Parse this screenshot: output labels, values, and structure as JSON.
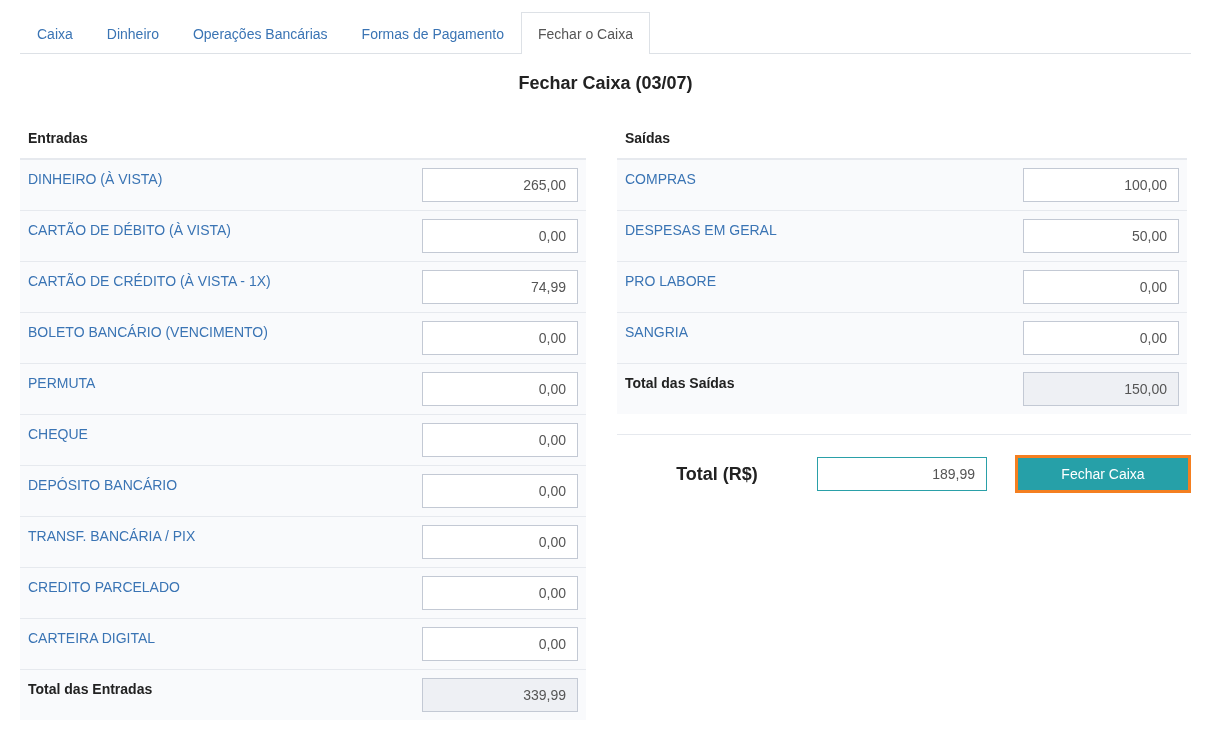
{
  "tabs": [
    {
      "label": "Caixa",
      "selected": false
    },
    {
      "label": "Dinheiro",
      "selected": false
    },
    {
      "label": "Operações Bancárias",
      "selected": false
    },
    {
      "label": "Formas de Pagamento",
      "selected": false
    },
    {
      "label": "Fechar o Caixa",
      "selected": true
    }
  ],
  "title": "Fechar Caixa (03/07)",
  "entradas": {
    "heading": "Entradas",
    "rows": [
      {
        "label": "DINHEIRO (À VISTA)",
        "value": "265,00"
      },
      {
        "label": "CARTÃO DE DÉBITO (À VISTA)",
        "value": "0,00"
      },
      {
        "label": "CARTÃO DE CRÉDITO (À VISTA - 1X)",
        "value": "74,99"
      },
      {
        "label": "BOLETO BANCÁRIO (VENCIMENTO)",
        "value": "0,00"
      },
      {
        "label": "PERMUTA",
        "value": "0,00"
      },
      {
        "label": "CHEQUE",
        "value": "0,00"
      },
      {
        "label": "DEPÓSITO BANCÁRIO",
        "value": "0,00"
      },
      {
        "label": "TRANSF. BANCÁRIA / PIX",
        "value": "0,00"
      },
      {
        "label": "CREDITO PARCELADO",
        "value": "0,00"
      },
      {
        "label": "CARTEIRA DIGITAL",
        "value": "0,00"
      }
    ],
    "total": {
      "label": "Total das Entradas",
      "value": "339,99"
    }
  },
  "saidas": {
    "heading": "Saídas",
    "rows": [
      {
        "label": "COMPRAS",
        "value": "100,00"
      },
      {
        "label": "DESPESAS EM GERAL",
        "value": "50,00"
      },
      {
        "label": "PRO LABORE",
        "value": "0,00"
      },
      {
        "label": "SANGRIA",
        "value": "0,00"
      }
    ],
    "total": {
      "label": "Total das Saídas",
      "value": "150,00"
    }
  },
  "summary": {
    "label": "Total (R$)",
    "value": "189,99",
    "button": {
      "label": "Fechar Caixa",
      "focused": true
    }
  }
}
